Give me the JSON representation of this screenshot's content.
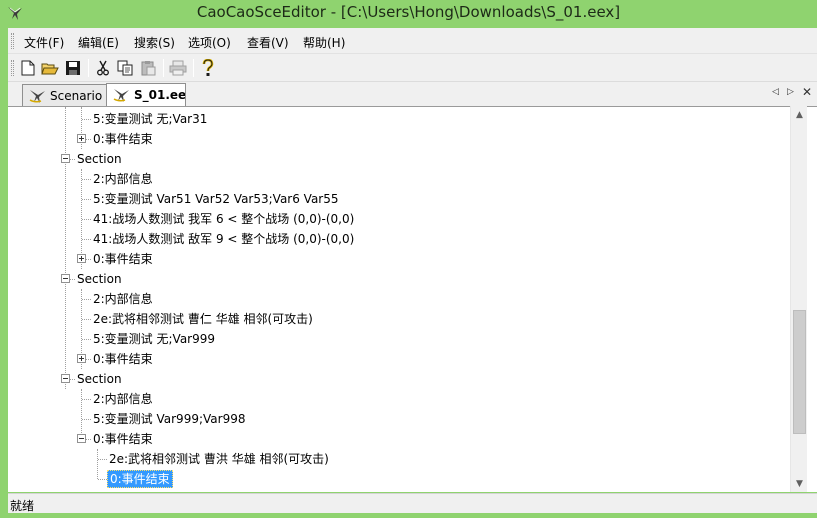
{
  "window": {
    "title": "CaoCaoSceEditor - [C:\\Users\\Hong\\Downloads\\S_01.eex]"
  },
  "menu": [
    {
      "label": "文件(F)"
    },
    {
      "label": "编辑(E)"
    },
    {
      "label": "搜索(S)"
    },
    {
      "label": "选项(O)"
    },
    {
      "label": "查看(V)"
    },
    {
      "label": "帮助(H)"
    }
  ],
  "toolbar": {
    "buttons": [
      {
        "icon": "new-file-icon"
      },
      {
        "icon": "open-folder-icon"
      },
      {
        "icon": "save-icon"
      },
      {
        "icon": "cut-icon"
      },
      {
        "icon": "copy-icon"
      },
      {
        "icon": "paste-icon"
      },
      {
        "icon": "print-icon"
      },
      {
        "icon": "help-icon"
      }
    ]
  },
  "tabs": [
    {
      "label": "Scenario"
    },
    {
      "label": "S_01.eex",
      "active": true
    }
  ],
  "tree": {
    "rows": [
      {
        "label": "5:变量测试 无;Var31",
        "level": 2,
        "expander": null
      },
      {
        "label": "0:事件结束",
        "level": 2,
        "expander": "plus"
      },
      {
        "label": "Section",
        "level": 1,
        "expander": "minus"
      },
      {
        "label": "2:内部信息",
        "level": 2,
        "expander": null
      },
      {
        "label": "5:变量测试 Var51 Var52 Var53;Var6 Var55",
        "level": 2,
        "expander": null
      },
      {
        "label": "41:战场人数测试 我军 6 < 整个战场 (0,0)-(0,0)",
        "level": 2,
        "expander": null
      },
      {
        "label": "41:战场人数测试 敌军 9 < 整个战场 (0,0)-(0,0)",
        "level": 2,
        "expander": null
      },
      {
        "label": "0:事件结束",
        "level": 2,
        "expander": "plus"
      },
      {
        "label": "Section",
        "level": 1,
        "expander": "minus"
      },
      {
        "label": "2:内部信息",
        "level": 2,
        "expander": null
      },
      {
        "label": "2e:武将相邻测试 曹仁 华雄 相邻(可攻击)",
        "level": 2,
        "expander": null
      },
      {
        "label": "5:变量测试 无;Var999",
        "level": 2,
        "expander": null
      },
      {
        "label": "0:事件结束",
        "level": 2,
        "expander": "plus"
      },
      {
        "label": "Section",
        "level": 1,
        "expander": "minus"
      },
      {
        "label": "2:内部信息",
        "level": 2,
        "expander": null
      },
      {
        "label": "5:变量测试 Var999;Var998",
        "level": 2,
        "expander": null
      },
      {
        "label": "0:事件结束",
        "level": 2,
        "expander": "minus"
      },
      {
        "label": "2e:武将相邻测试 曹洪 华雄 相邻(可攻击)",
        "level": 3,
        "expander": null
      },
      {
        "label": "0:事件结束",
        "level": 3,
        "expander": null,
        "selected": true
      }
    ]
  },
  "scrollbar": {
    "up_arrow": "▲",
    "down_arrow": "▼",
    "position_fraction": 0.82
  },
  "status": {
    "text": "就绪"
  },
  "colors": {
    "frame": "#8fd36f",
    "selection": "#3399ff"
  }
}
